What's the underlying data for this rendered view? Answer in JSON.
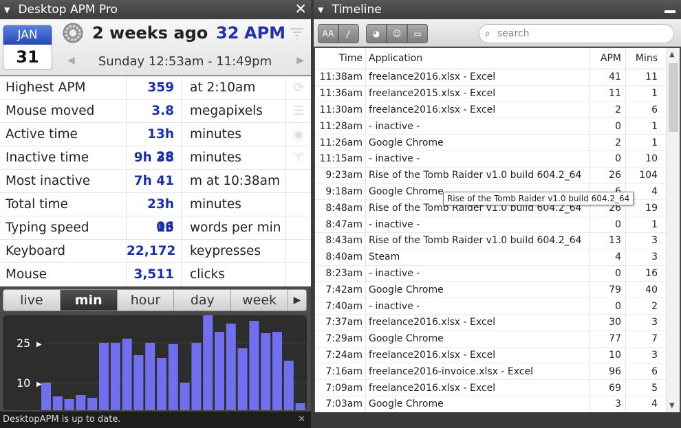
{
  "left": {
    "title": "Desktop APM Pro",
    "calendar": {
      "month": "JAN",
      "day": "31"
    },
    "ago": "2 weeks ago",
    "apm_value": "32",
    "apm_label": "APM",
    "date_range": "Sunday 12:53am - 11:49pm",
    "stats": [
      {
        "label": "Highest APM",
        "value": "359",
        "unit": "at 2:10am"
      },
      {
        "label": "Mouse moved",
        "value": "3.8",
        "unit": "megapixels"
      },
      {
        "label": "Active time",
        "value": "13h 28",
        "unit": "minutes"
      },
      {
        "label": "Inactive time",
        "value": "9h 38",
        "unit": "minutes"
      },
      {
        "label": "Most inactive",
        "value": "7h 41",
        "unit": "m at 10:38am"
      },
      {
        "label": "Total time",
        "value": "23h 06",
        "unit": "minutes"
      },
      {
        "label": "Typing speed",
        "value": "13",
        "unit": "words per min"
      },
      {
        "label": "Keyboard",
        "value": "22,172",
        "unit": "keypresses"
      },
      {
        "label": "Mouse",
        "value": "3,511",
        "unit": "clicks"
      }
    ],
    "tabs": [
      "live",
      "min",
      "hour",
      "day",
      "week"
    ],
    "active_tab": "min",
    "chart_labels": [
      "25",
      "10"
    ],
    "status": "DesktopAPM is up to date.",
    "bar_color": "#6f6ff0"
  },
  "right": {
    "title": "Timeline",
    "search_placeholder": "search",
    "headers": {
      "time": "Time",
      "app": "Application",
      "apm": "APM",
      "mins": "Mins"
    },
    "rows": [
      {
        "time": "11:38am",
        "app": "freelance2016.xlsx - Excel",
        "apm": "41",
        "mins": "11"
      },
      {
        "time": "11:36am",
        "app": "freelance2015.xlsx - Excel",
        "apm": "11",
        "mins": "1"
      },
      {
        "time": "11:30am",
        "app": "freelance2016.xlsx - Excel",
        "apm": "2",
        "mins": "6"
      },
      {
        "time": "11:28am",
        "app": "- inactive -",
        "apm": "0",
        "mins": "1"
      },
      {
        "time": "11:26am",
        "app": "Google Chrome",
        "apm": "2",
        "mins": "1"
      },
      {
        "time": "11:15am",
        "app": "- inactive -",
        "apm": "0",
        "mins": "10"
      },
      {
        "time": "9:23am",
        "app": "Rise of the Tomb Raider v1.0 build 604.2_64",
        "apm": "26",
        "mins": "104"
      },
      {
        "time": "9:18am",
        "app": "Google Chrome",
        "apm": "6",
        "mins": "4"
      },
      {
        "time": "8:48am",
        "app": "Rise of the Tomb Raider v1.0 build 604.2_64",
        "apm": "26",
        "mins": "19"
      },
      {
        "time": "8:47am",
        "app": "- inactive -",
        "apm": "0",
        "mins": "1"
      },
      {
        "time": "8:43am",
        "app": "Rise of the Tomb Raider v1.0 build 604.2_64",
        "apm": "13",
        "mins": "3"
      },
      {
        "time": "8:40am",
        "app": "Steam",
        "apm": "4",
        "mins": "3"
      },
      {
        "time": "8:23am",
        "app": "- inactive -",
        "apm": "0",
        "mins": "16"
      },
      {
        "time": "7:42am",
        "app": "Google Chrome",
        "apm": "79",
        "mins": "40"
      },
      {
        "time": "7:40am",
        "app": "- inactive -",
        "apm": "0",
        "mins": "2"
      },
      {
        "time": "7:37am",
        "app": "freelance2016.xlsx - Excel",
        "apm": "30",
        "mins": "3"
      },
      {
        "time": "7:29am",
        "app": "Google Chrome",
        "apm": "77",
        "mins": "7"
      },
      {
        "time": "7:24am",
        "app": "freelance2016.xlsx - Excel",
        "apm": "10",
        "mins": "3"
      },
      {
        "time": "7:16am",
        "app": "freelance2016-invoice.xlsx - Excel",
        "apm": "96",
        "mins": "6"
      },
      {
        "time": "7:09am",
        "app": "freelance2016.xlsx - Excel",
        "apm": "69",
        "mins": "5"
      },
      {
        "time": "7:03am",
        "app": "Google Chrome",
        "apm": "3",
        "mins": "4"
      }
    ],
    "tooltip": "Rise of the Tomb Raider v1.0 build 604.2_64"
  }
}
